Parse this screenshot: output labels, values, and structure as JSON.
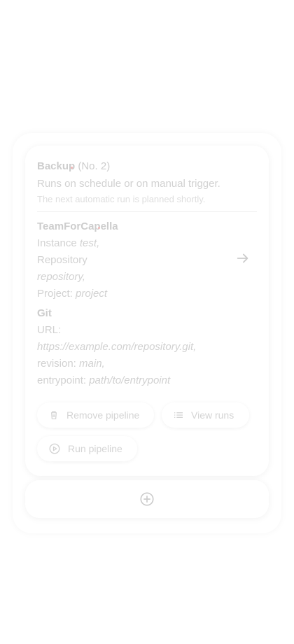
{
  "pipeline": {
    "name": "Backup",
    "number": "(No. 2)",
    "trigger_text": "Runs on schedule or on manual trigger.",
    "next_run_text": "The next automatic run is planned shortly."
  },
  "source": {
    "section_title": "TeamForCapella",
    "instance_label": "Instance",
    "instance_value": "test,",
    "repository_label": "Repository",
    "repository_value": "repository,",
    "project_label": "Project:",
    "project_value": "project"
  },
  "git": {
    "section_title": "Git",
    "url_label": "URL:",
    "url_value": "https://example.com/repository.git,",
    "revision_label": "revision:",
    "revision_value": "main,",
    "entrypoint_label": "entrypoint:",
    "entrypoint_value": "path/to/entrypoint"
  },
  "actions": {
    "remove_label": "Remove pipeline",
    "view_runs_label": "View runs",
    "run_label": "Run pipeline"
  },
  "icons": {
    "arrow": "arrow-right-icon",
    "trash": "trash-icon",
    "list": "list-icon",
    "play": "play-circle-icon",
    "add": "add-circle-icon"
  }
}
